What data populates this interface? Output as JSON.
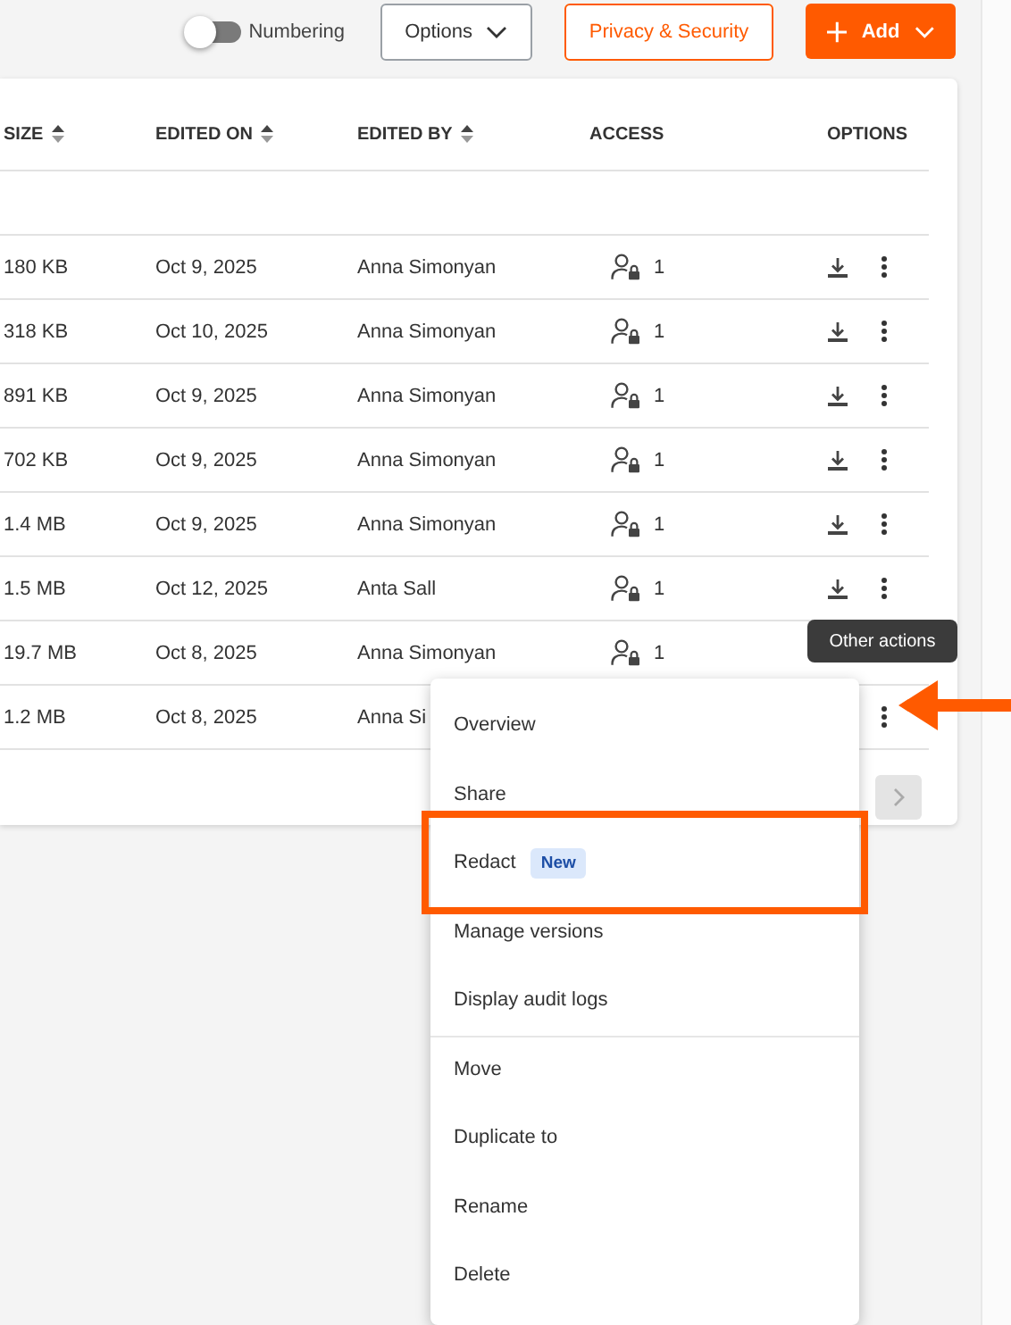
{
  "toolbar": {
    "numbering": {
      "label": "Numbering",
      "on": false
    },
    "buttons": [
      {
        "label": "Options",
        "kind": "dropdown"
      },
      {
        "label": "Privacy & Security",
        "kind": "outline"
      },
      {
        "label": "Add",
        "kind": "primary"
      }
    ]
  },
  "table": {
    "columns": [
      {
        "label": "SIZE",
        "sortable": true
      },
      {
        "label": "EDITED ON",
        "sortable": true
      },
      {
        "label": "EDITED BY",
        "sortable": true
      },
      {
        "label": "ACCESS",
        "sortable": false
      },
      {
        "label": "OPTIONS",
        "sortable": false
      }
    ],
    "rows": [
      {
        "size": "180 KB",
        "edited_on": "Oct 9, 2025",
        "edited_by": "Anna Simonyan",
        "access": "1",
        "show_download": true,
        "show_more": true
      },
      {
        "size": "318 KB",
        "edited_on": "Oct 10, 2025",
        "edited_by": "Anna Simonyan",
        "access": "1",
        "show_download": true,
        "show_more": true
      },
      {
        "size": "891 KB",
        "edited_on": "Oct 9, 2025",
        "edited_by": "Anna Simonyan",
        "access": "1",
        "show_download": true,
        "show_more": true
      },
      {
        "size": "702 KB",
        "edited_on": "Oct 9, 2025",
        "edited_by": "Anna Simonyan",
        "access": "1",
        "show_download": true,
        "show_more": true
      },
      {
        "size": "1.4 MB",
        "edited_on": "Oct 9, 2025",
        "edited_by": "Anna Simonyan",
        "access": "1",
        "show_download": true,
        "show_more": true
      },
      {
        "size": "1.5 MB",
        "edited_on": "Oct 12, 2025",
        "edited_by": "Anta Sall",
        "access": "1",
        "show_download": true,
        "show_more": true
      },
      {
        "size": "19.7 MB",
        "edited_on": "Oct 8, 2025",
        "edited_by": "Anna Simonyan",
        "access": "1",
        "show_download": false,
        "show_more": false
      },
      {
        "size": "1.2 MB",
        "edited_on": "Oct 8, 2025",
        "edited_by": "Anna Si",
        "show_download": false,
        "show_more": true
      }
    ],
    "pagination": {
      "next_disabled": true
    }
  },
  "tooltip": {
    "text": "Other actions"
  },
  "context_menu": {
    "items": [
      {
        "label": "Overview",
        "highlighted": false,
        "divider_before": false
      },
      {
        "label": "Share",
        "highlighted": false,
        "divider_before": false
      },
      {
        "label": "Redact",
        "badge": "New",
        "highlighted": true,
        "divider_before": false
      },
      {
        "label": "Manage versions",
        "highlighted": false,
        "divider_before": false
      },
      {
        "label": "Display audit logs",
        "highlighted": false,
        "divider_before": false
      },
      {
        "label": "Move",
        "highlighted": false,
        "divider_before": true
      },
      {
        "label": "Duplicate to",
        "highlighted": false,
        "divider_before": false
      },
      {
        "label": "Rename",
        "highlighted": false,
        "divider_before": false
      },
      {
        "label": "Delete",
        "highlighted": false,
        "divider_before": false
      }
    ]
  }
}
